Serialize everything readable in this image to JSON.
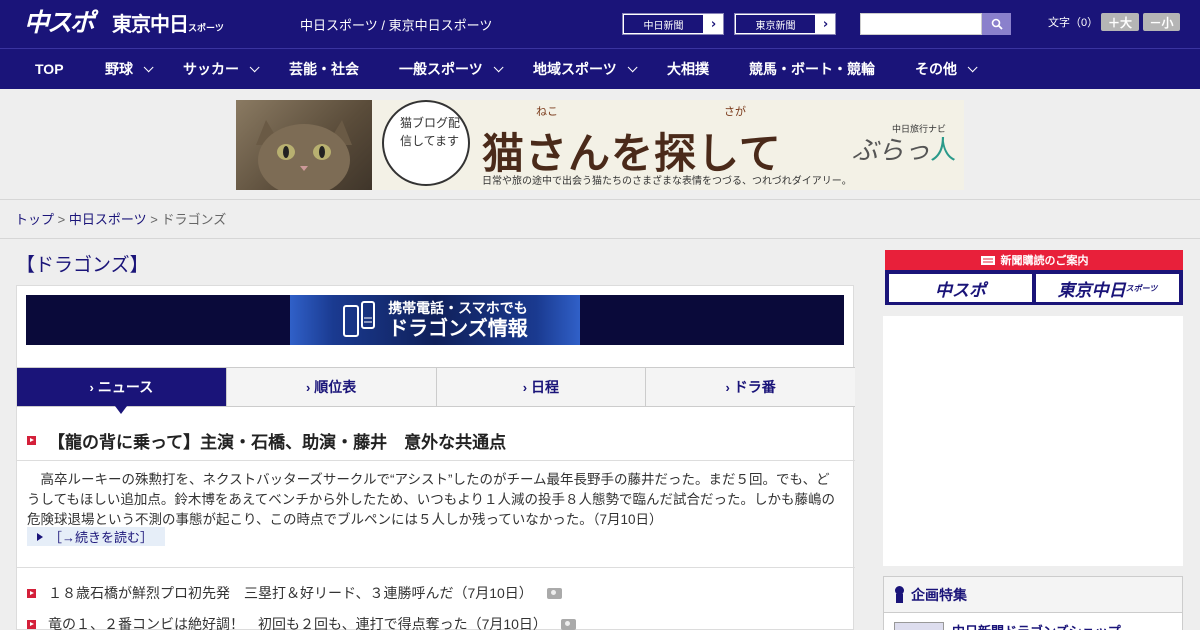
{
  "header": {
    "logo_main": "中スポ",
    "logo_sub": "東京中日",
    "logo_sub_small": "スポーツ",
    "site_title": "中日スポーツ / 東京中日スポーツ",
    "paper_links": [
      {
        "label": "中日新聞"
      },
      {
        "label": "東京新聞"
      }
    ],
    "search_placeholder": "",
    "font_size_label": "文字（0）",
    "font_larger": "＋大",
    "font_smaller": "－小"
  },
  "nav": {
    "items": [
      {
        "label": "TOP",
        "has_dropdown": false
      },
      {
        "label": "野球",
        "has_dropdown": true
      },
      {
        "label": "サッカー",
        "has_dropdown": true
      },
      {
        "label": "芸能・社会",
        "has_dropdown": false
      },
      {
        "label": "一般スポーツ",
        "has_dropdown": true
      },
      {
        "label": "地域スポーツ",
        "has_dropdown": true
      },
      {
        "label": "大相撲",
        "has_dropdown": false
      },
      {
        "label": "競馬・ボート・競輪",
        "has_dropdown": false
      },
      {
        "label": "その他",
        "has_dropdown": true
      }
    ]
  },
  "ad_banner": {
    "bubble_text": "猫ブログ配信してます",
    "title": "猫さんを探して",
    "ruby_neko": "ねこ",
    "ruby_saga": "さが",
    "brand_small": "中日旅行ナビ",
    "brand_a": "ぶらっ",
    "brand_b": "人",
    "subtitle": "日常や旅の途中で出会う猫たちのさまざまな表情をつづる、つれづれダイアリー。"
  },
  "breadcrumb": {
    "items": [
      "トップ",
      "中日スポーツ"
    ],
    "current": "ドラゴンズ",
    "separator": ">"
  },
  "page_title": "【ドラゴンズ】",
  "mobile_banner": {
    "line1": "携帯電話・スマホでも",
    "line2": "ドラゴンズ情報"
  },
  "tabs": [
    {
      "label": "ニュース",
      "active": true
    },
    {
      "label": "順位表",
      "active": false
    },
    {
      "label": "日程",
      "active": false
    },
    {
      "label": "ドラ番",
      "active": false
    }
  ],
  "top_story": {
    "headline": "【龍の背に乗って】主演・石橋、助演・藤井　意外な共通点",
    "lead": "　高卒ルーキーの殊勲打を、ネクストバッターズサークルで“アシスト”したのがチーム最年長野手の藤井だった。まだ５回。でも、どうしてもほしい追加点。鈴木博をあえてベンチから外したため、いつもより１人減の投手８人態勢で臨んだ試合だった。しかも藤嶋の危険球退場という不測の事態が起こり、この時点でブルペンには５人しか残っていなかった。（7月10日）",
    "read_more": "［→続きを読む］"
  },
  "news_list": [
    {
      "title": "１８歳石橋が鮮烈プロ初先発　三塁打＆好リード、３連勝呼んだ（7月10日）",
      "has_photo": true
    },
    {
      "title": "竜の１、２番コンビは絶好調！　初回も２回も、連打で得点奪った（7月10日）",
      "has_photo": true
    }
  ],
  "sidebar": {
    "subscription_heading": "新聞購読のご案内",
    "subscription_buttons": [
      "中スポ",
      "東京中日"
    ],
    "subscription_small": "スポーツ",
    "feature_heading": "企画特集",
    "feature_item": "中日新聞ドラゴンズショップ"
  },
  "colors": {
    "brand_navy": "#1a1479",
    "accent_red": "#d4203a",
    "page_bg": "#eeeeee"
  }
}
